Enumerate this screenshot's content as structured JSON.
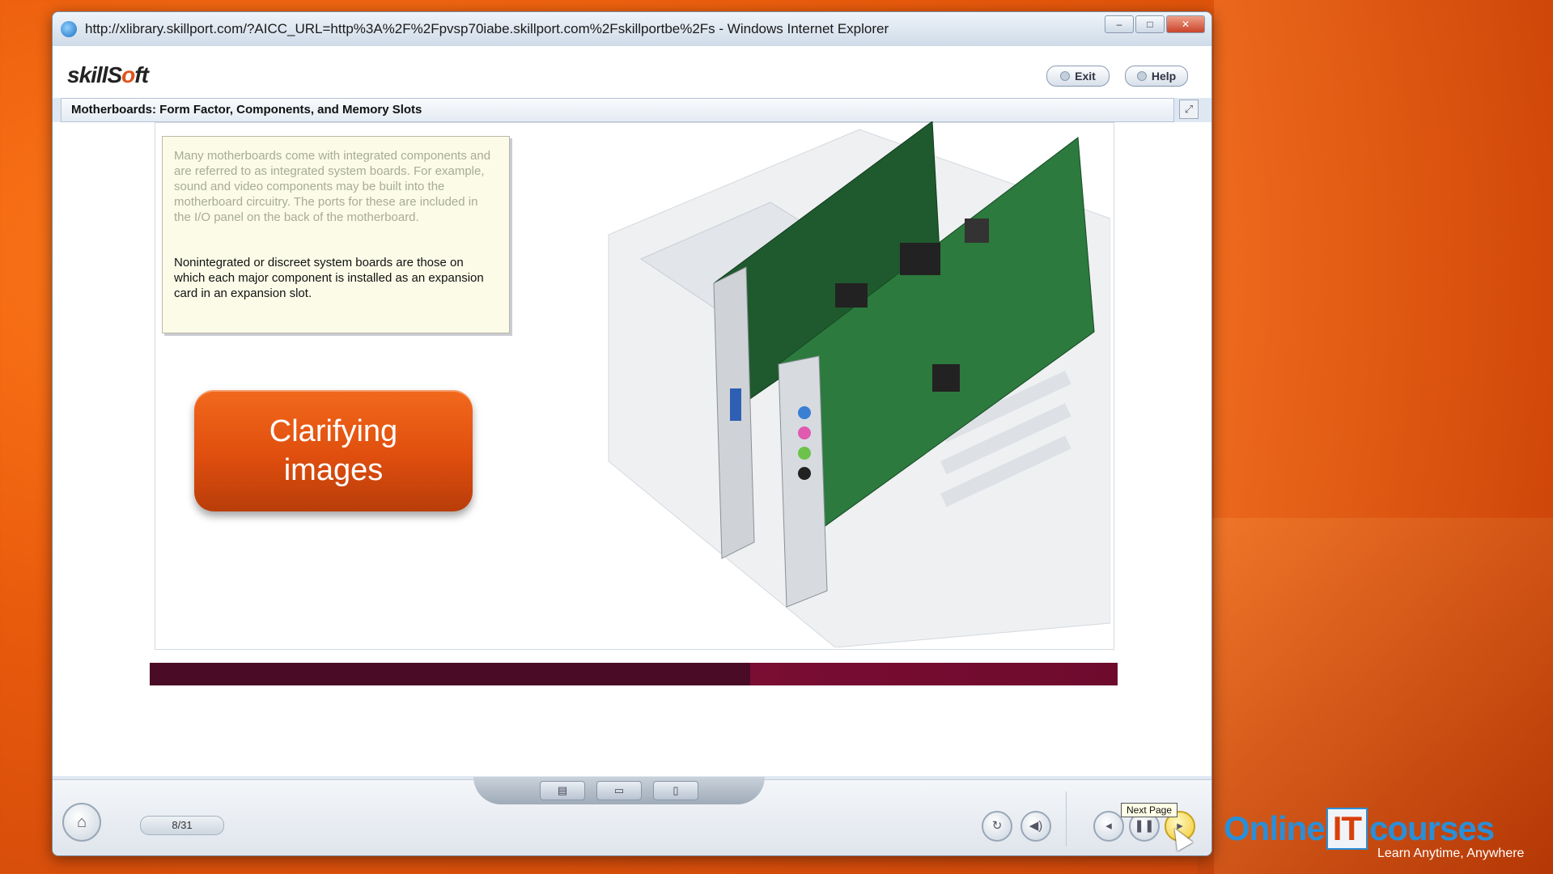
{
  "window": {
    "title": "http://xlibrary.skillport.com/?AICC_URL=http%3A%2F%2Fpvsp70iabe.skillport.com%2Fskillportbe%2Fs - Windows Internet Explorer",
    "buttons": {
      "minimize": "–",
      "maximize": "□",
      "close": "✕"
    }
  },
  "app": {
    "logo_prefix": "skillS",
    "logo_o": "o",
    "logo_suffix": "ft",
    "exit_label": "Exit",
    "help_label": "Help",
    "course_title": "Motherboards: Form Factor, Components, and Memory Slots"
  },
  "slide": {
    "callout_muted": "Many motherboards come with integrated components and are referred to as integrated system boards. For example, sound and video components may be built into the motherboard circuitry. The ports for these are included in the I/O panel on the back of the motherboard.",
    "callout_main": "Nonintegrated or discreet system boards are those on which each major component is installed as an expansion card in an expansion slot.",
    "highlight_line1": "Clarifying",
    "highlight_line2": "images"
  },
  "progress": {
    "fraction": 0.62
  },
  "footer": {
    "page_indicator": "8/31",
    "next_tooltip": "Next Page"
  },
  "watermark": {
    "brand_left": "Online",
    "brand_it": "IT",
    "brand_right": "courses",
    "tagline": "Learn Anytime, Anywhere"
  },
  "colors": {
    "accent": "#df4e0e",
    "progress": "#5a0f2e",
    "desktop": "#e85a0c"
  }
}
